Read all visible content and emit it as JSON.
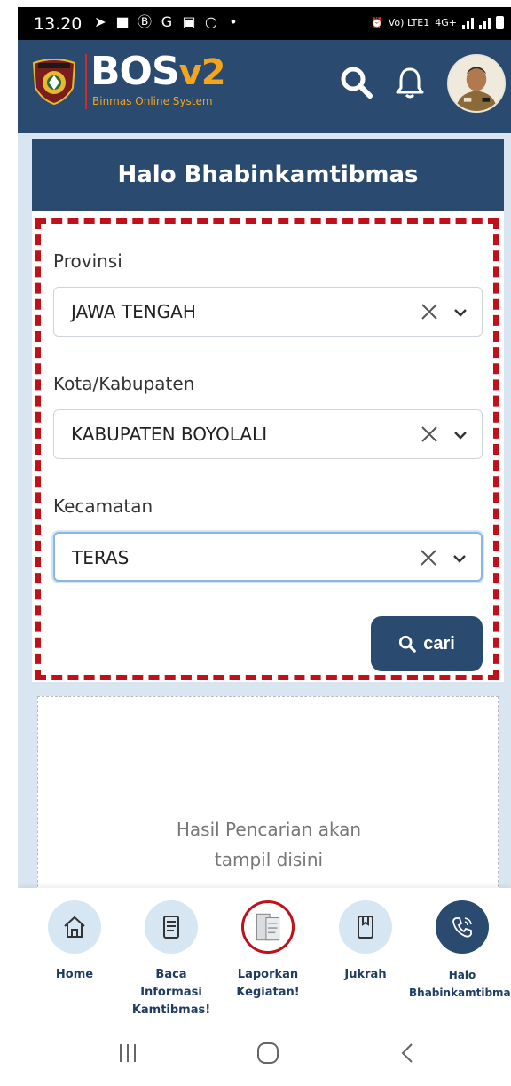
{
  "status_bar": {
    "time": "13.20",
    "network_label": "4G+",
    "volte_label": "Vo) LTE1"
  },
  "header": {
    "brand_name": "BOS",
    "brand_version": "v2",
    "brand_tagline": "Binmas Online System",
    "search_icon": "search-icon",
    "bell_icon": "bell-icon"
  },
  "greeting": {
    "text": "Halo Bhabinkamtibmas"
  },
  "form": {
    "provinsi": {
      "label": "Provinsi",
      "value": "JAWA TENGAH"
    },
    "kota": {
      "label": "Kota/Kabupaten",
      "value": "KABUPATEN BOYOLALI"
    },
    "kecamatan": {
      "label": "Kecamatan",
      "value": "TERAS"
    },
    "search_button": "cari"
  },
  "results": {
    "line1": "Hasil Pencarian akan",
    "line2": "tampil disini"
  },
  "bottom_nav": {
    "items": [
      {
        "label": "Home",
        "icon": "home-icon"
      },
      {
        "label": "Baca Informasi Kamtibmas!",
        "icon": "document-icon"
      },
      {
        "label": "Laporkan Kegiatan!",
        "icon": "report-icon"
      },
      {
        "label": "Jukrah",
        "icon": "book-icon"
      },
      {
        "label": "Halo Bhabinkamtibmas",
        "icon": "phone-icon"
      }
    ]
  },
  "colors": {
    "primary": "#2a4a70",
    "accent": "#f3a51b",
    "highlight_border": "#c0111b",
    "content_bg": "#d9e6f1",
    "nav_circle": "#d6e6f3"
  }
}
